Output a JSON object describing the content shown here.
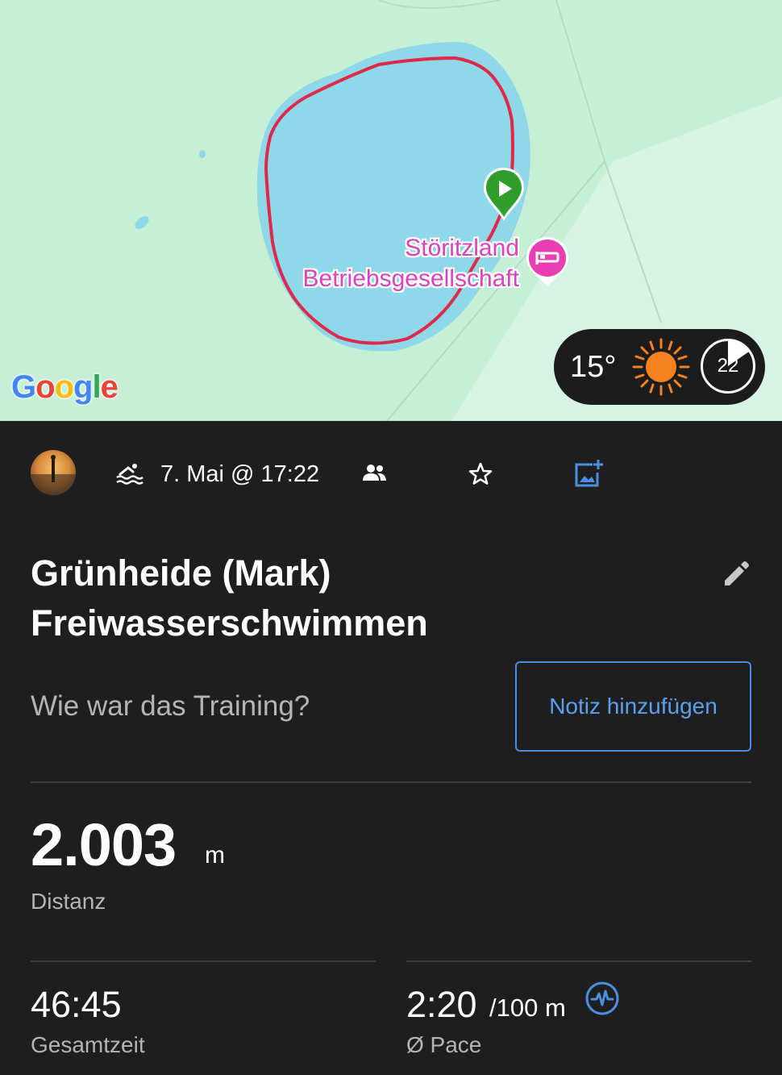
{
  "map": {
    "poi_line1": "Störitzland",
    "poi_line2": "Betriebsgesellschaft",
    "logo": "Google",
    "icons": [
      "start-marker-icon",
      "hotel-marker-icon"
    ]
  },
  "weather": {
    "temperature": "15°",
    "icon": "sun-icon",
    "wind": "22"
  },
  "activity": {
    "type_icon": "open-water-swim-icon",
    "datetime": "7. Mai @ 17:22",
    "title_line1": "Grünheide (Mark)",
    "title_line2": "Freiwasserschwimmen",
    "question": "Wie war das Training?",
    "note_button": "Notiz hinzufügen"
  },
  "stats": {
    "distance_value": "2.003",
    "distance_unit": "m",
    "distance_label": "Distanz",
    "time_value": "46:45",
    "time_label": "Gesamtzeit",
    "pace_value": "2:20",
    "pace_unit": "/100 m",
    "pace_label": "Ø Pace"
  },
  "colors": {
    "background": "#1e1e1e",
    "accent_blue": "#4a90e2",
    "route_red": "#e0284a",
    "water": "#8fd8ea",
    "land": "#c8efd8",
    "poi_magenta": "#e040c0"
  }
}
